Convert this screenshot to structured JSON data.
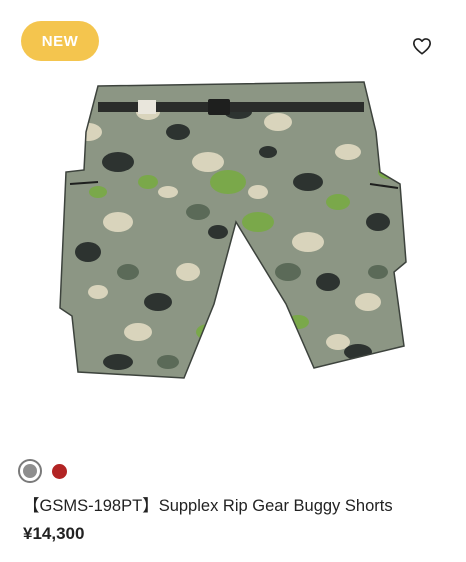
{
  "badge": {
    "label": "NEW",
    "color": "#f4c54e"
  },
  "favorite": {
    "icon": "heart-outline-icon"
  },
  "product": {
    "title": "【GSMS-198PT】Supplex Rip Gear Buggy Shorts",
    "price": "¥14,300",
    "image": "camo-cargo-shorts",
    "swatches": [
      {
        "name": "gray",
        "color": "#8e8e8e",
        "selected": true
      },
      {
        "name": "red",
        "color": "#b22424",
        "selected": false
      }
    ]
  }
}
